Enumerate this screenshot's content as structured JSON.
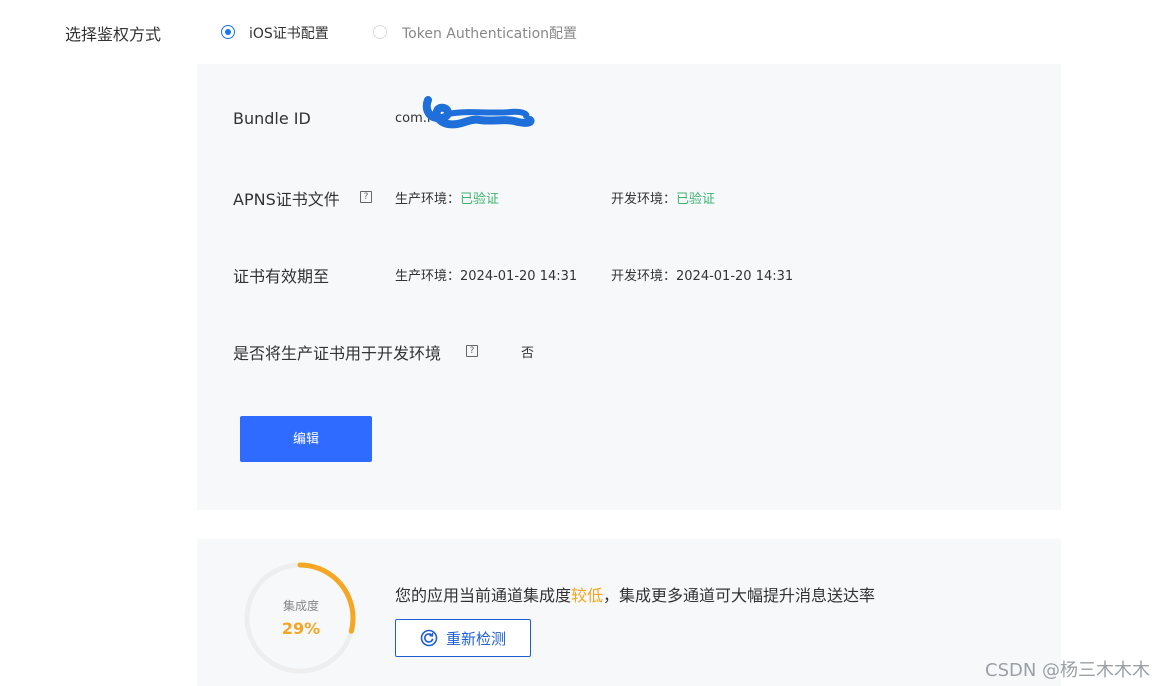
{
  "auth": {
    "label": "选择鉴权方式",
    "options": [
      {
        "label": "iOS证书配置",
        "selected": true
      },
      {
        "label": "Token Authentication配置",
        "selected": false
      }
    ]
  },
  "cert_panel": {
    "bundle_id": {
      "label": "Bundle ID",
      "value": "com.l"
    },
    "apns": {
      "label": "APNS证书文件",
      "prod_label": "生产环境：",
      "prod_value": "已验证",
      "dev_label": "开发环境：",
      "dev_value": "已验证"
    },
    "expiry": {
      "label": "证书有效期至",
      "prod_label": "生产环境：",
      "prod_value": "2024-01-20 14:31",
      "dev_label": "开发环境：",
      "dev_value": "2024-01-20 14:31"
    },
    "use_prod_for_dev": {
      "label": "是否将生产证书用于开发环境",
      "value": "否"
    },
    "edit_button": "编辑"
  },
  "integration": {
    "gauge_label": "集成度",
    "gauge_value_text": "29%",
    "gauge_fraction": 0.29,
    "message_prefix": "您的应用当前通道集成度",
    "message_highlight": "较低",
    "message_suffix": "，集成更多通道可大幅提升消息送达率",
    "recheck_button": "重新检测"
  },
  "watermark": "CSDN @杨三木木木",
  "colors": {
    "accent": "#2f6bff",
    "verified": "#3cb371",
    "warning": "#f5a623",
    "panel_bg": "#f7f8fa"
  }
}
